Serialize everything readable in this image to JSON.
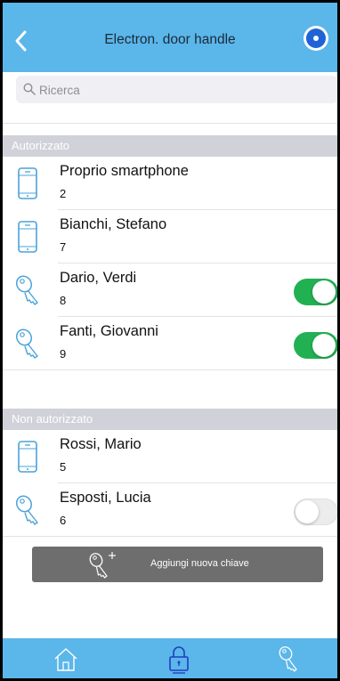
{
  "header": {
    "title": "Electron. door handle"
  },
  "search": {
    "placeholder": "Ricerca"
  },
  "sections": {
    "authorized": "Autorizzato",
    "unauthorized": "Non autorizzato"
  },
  "authorized_items": [
    {
      "name": "Proprio smartphone",
      "number": "2",
      "icon": "smartphone-icon"
    },
    {
      "name": "Bianchi,  Stefano",
      "number": "7",
      "icon": "smartphone-icon"
    },
    {
      "name": "Dario, Verdi",
      "number": "8",
      "icon": "key-icon",
      "toggle": "on"
    },
    {
      "name": "Fanti, Giovanni",
      "number": "9",
      "icon": "key-icon",
      "toggle": "on"
    }
  ],
  "unauthorized_items": [
    {
      "name": "Rossi,  Mario",
      "number": "5",
      "icon": "smartphone-icon"
    },
    {
      "name": "Esposti, Lucia",
      "number": "6",
      "icon": "key-icon",
      "toggle": "off"
    }
  ],
  "actions": {
    "add_key_label": "Aggiungi nuova chiave"
  },
  "bottom_nav": [
    {
      "icon": "home-icon"
    },
    {
      "icon": "lock-icon"
    },
    {
      "icon": "key-icon"
    }
  ],
  "colors": {
    "header_bg": "#5bb6ea",
    "toggle_on": "#22b152",
    "section_bg": "#d1d1d9",
    "button_bg": "#6e6e6e"
  }
}
